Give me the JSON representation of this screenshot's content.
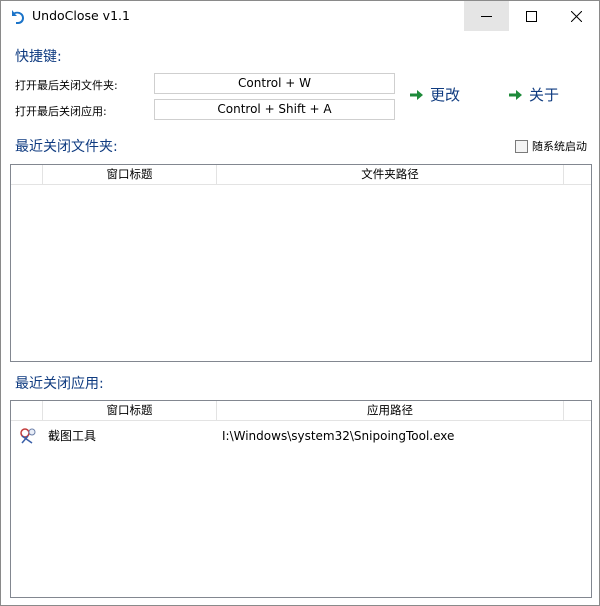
{
  "window": {
    "title": "UndoClose v1.1",
    "controls": {
      "minimize": "minimize-icon",
      "maximize": "maximize-icon",
      "close": "close-icon"
    }
  },
  "hotkeys": {
    "section_title": "快捷键:",
    "folder_label": "打开最后关闭文件夹:",
    "folder_value": "Control + W",
    "app_label": "打开最后关闭应用:",
    "app_value": "Control + Shift + A",
    "change_button": "更改",
    "about_button": "关于"
  },
  "folders": {
    "section_title": "最近关闭文件夹:",
    "autostart_label": "随系统启动",
    "autostart_checked": false,
    "columns": [
      "",
      "窗口标题",
      "文件夹路径",
      ""
    ],
    "rows": []
  },
  "apps": {
    "section_title": "最近关闭应用:",
    "columns": [
      "",
      "窗口标题",
      "应用路径",
      ""
    ],
    "rows": [
      {
        "icon": "snipping-tool-icon",
        "title": "截图工具",
        "path": "I:\\Windows\\system32\\SnipoingTool.exe"
      }
    ]
  },
  "colors": {
    "accent": "#0f3b80",
    "arrow": "#1e8a3a"
  }
}
